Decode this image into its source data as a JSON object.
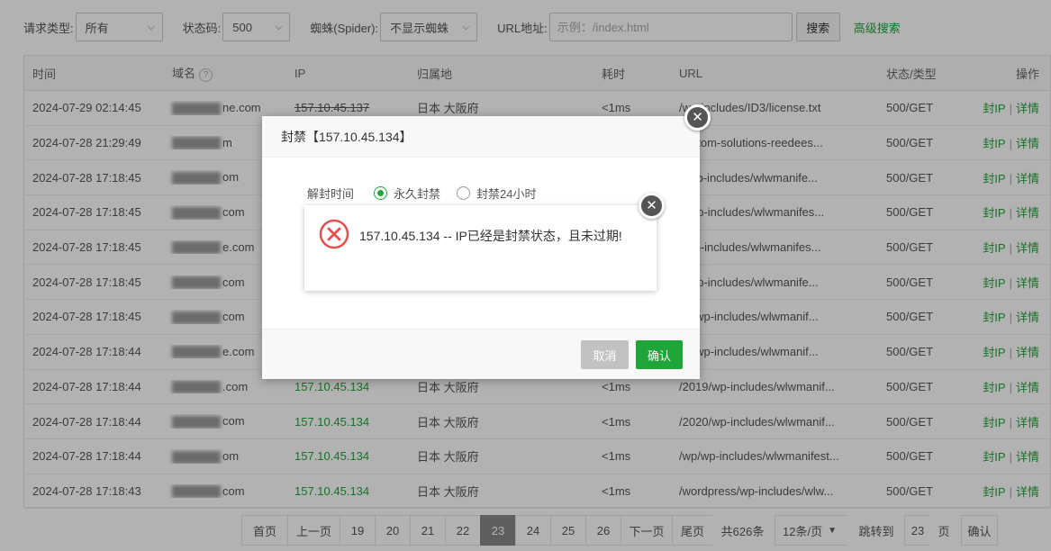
{
  "filters": {
    "request_type_label": "请求类型:",
    "request_type_value": "所有",
    "status_code_label": "状态码:",
    "status_code_value": "500",
    "spider_label": "蜘蛛(Spider):",
    "spider_value": "不显示蜘蛛",
    "url_label": "URL地址:",
    "url_placeholder": "示例：/index.html",
    "search_button": "搜索",
    "advanced_search": "高级搜索"
  },
  "table": {
    "headers": {
      "time": "时间",
      "domain": "域名",
      "ip": "IP",
      "location": "归属地",
      "cost": "耗时",
      "url": "URL",
      "status": "状态/类型",
      "action": "操作"
    },
    "ban_ip_label": "封IP",
    "detail_label": "详情",
    "rows": [
      {
        "time": "2024-07-29 02:14:45",
        "domain": "ne.com",
        "ip": "157.10.45.137",
        "location": "日本 大阪府",
        "cost": "<1ms",
        "url": "/wp-includes/ID3/license.txt",
        "status": "500/GET"
      },
      {
        "time": "2024-07-28 21:29:49",
        "domain": "m",
        "ip": "",
        "location": "",
        "cost": "",
        "url": "custom-solutions-reedees...",
        "status": "500/GET"
      },
      {
        "time": "2024-07-28 17:18:45",
        "domain": "om",
        "ip": "",
        "location": "",
        "cost": "",
        "url": "s/wp-includes/wlwmanife...",
        "status": "500/GET"
      },
      {
        "time": "2024-07-28 17:18:45",
        "domain": "com",
        "ip": "",
        "location": "",
        "cost": "",
        "url": "e/wp-includes/wlwmanifes...",
        "status": "500/GET"
      },
      {
        "time": "2024-07-28 17:18:45",
        "domain": "e.com",
        "ip": "",
        "location": "",
        "cost": "",
        "url": "t/wp-includes/wlwmanifes...",
        "status": "500/GET"
      },
      {
        "time": "2024-07-28 17:18:45",
        "domain": "com",
        "ip": "",
        "location": "",
        "cost": "",
        "url": "1/wp-includes/wlwmanife...",
        "status": "500/GET"
      },
      {
        "time": "2024-07-28 17:18:45",
        "domain": "com",
        "ip": "",
        "location": "",
        "cost": "",
        "url": "op/wp-includes/wlwmanif...",
        "status": "500/GET"
      },
      {
        "time": "2024-07-28 17:18:44",
        "domain": "e.com",
        "ip": "",
        "location": "",
        "cost": "",
        "url": "21/wp-includes/wlwmanif...",
        "status": "500/GET"
      },
      {
        "time": "2024-07-28 17:18:44",
        "domain": ".com",
        "ip": "157.10.45.134",
        "location": "日本 大阪府",
        "cost": "<1ms",
        "url": "/2019/wp-includes/wlwmanif...",
        "status": "500/GET"
      },
      {
        "time": "2024-07-28 17:18:44",
        "domain": "com",
        "ip": "157.10.45.134",
        "location": "日本 大阪府",
        "cost": "<1ms",
        "url": "/2020/wp-includes/wlwmanif...",
        "status": "500/GET"
      },
      {
        "time": "2024-07-28 17:18:44",
        "domain": "om",
        "ip": "157.10.45.134",
        "location": "日本 大阪府",
        "cost": "<1ms",
        "url": "/wp/wp-includes/wlwmanifest...",
        "status": "500/GET"
      },
      {
        "time": "2024-07-28 17:18:43",
        "domain": "com",
        "ip": "157.10.45.134",
        "location": "日本 大阪府",
        "cost": "<1ms",
        "url": "/wordpress/wp-includes/wlw...",
        "status": "500/GET"
      }
    ]
  },
  "pagination": {
    "first": "首页",
    "prev": "上一页",
    "pages": [
      "19",
      "20",
      "21",
      "22",
      "23",
      "24",
      "25",
      "26"
    ],
    "current": "23",
    "next": "下一页",
    "last": "尾页",
    "total": "共626条",
    "per_page": "12条/页",
    "jump_label": "跳转到",
    "jump_value": "23",
    "page_unit": "页",
    "confirm": "确认"
  },
  "ban_dialog": {
    "title": "封禁【157.10.45.134】",
    "unban_time_label": "解封时间",
    "option_permanent": "永久封禁",
    "option_24h": "封禁24小时",
    "selected": "永久封禁",
    "cancel_button": "取消",
    "confirm_button": "确认"
  },
  "error_message": {
    "text": "157.10.45.134 -- IP已经是封禁状态，且未过期!"
  },
  "colors": {
    "accent_green": "#20a53a",
    "error_red": "#e4504d",
    "active_page": "#888888"
  },
  "icons": [
    "help-circle-icon",
    "chevron-down-icon",
    "close-icon",
    "error-circle-icon",
    "radio-icon"
  ]
}
